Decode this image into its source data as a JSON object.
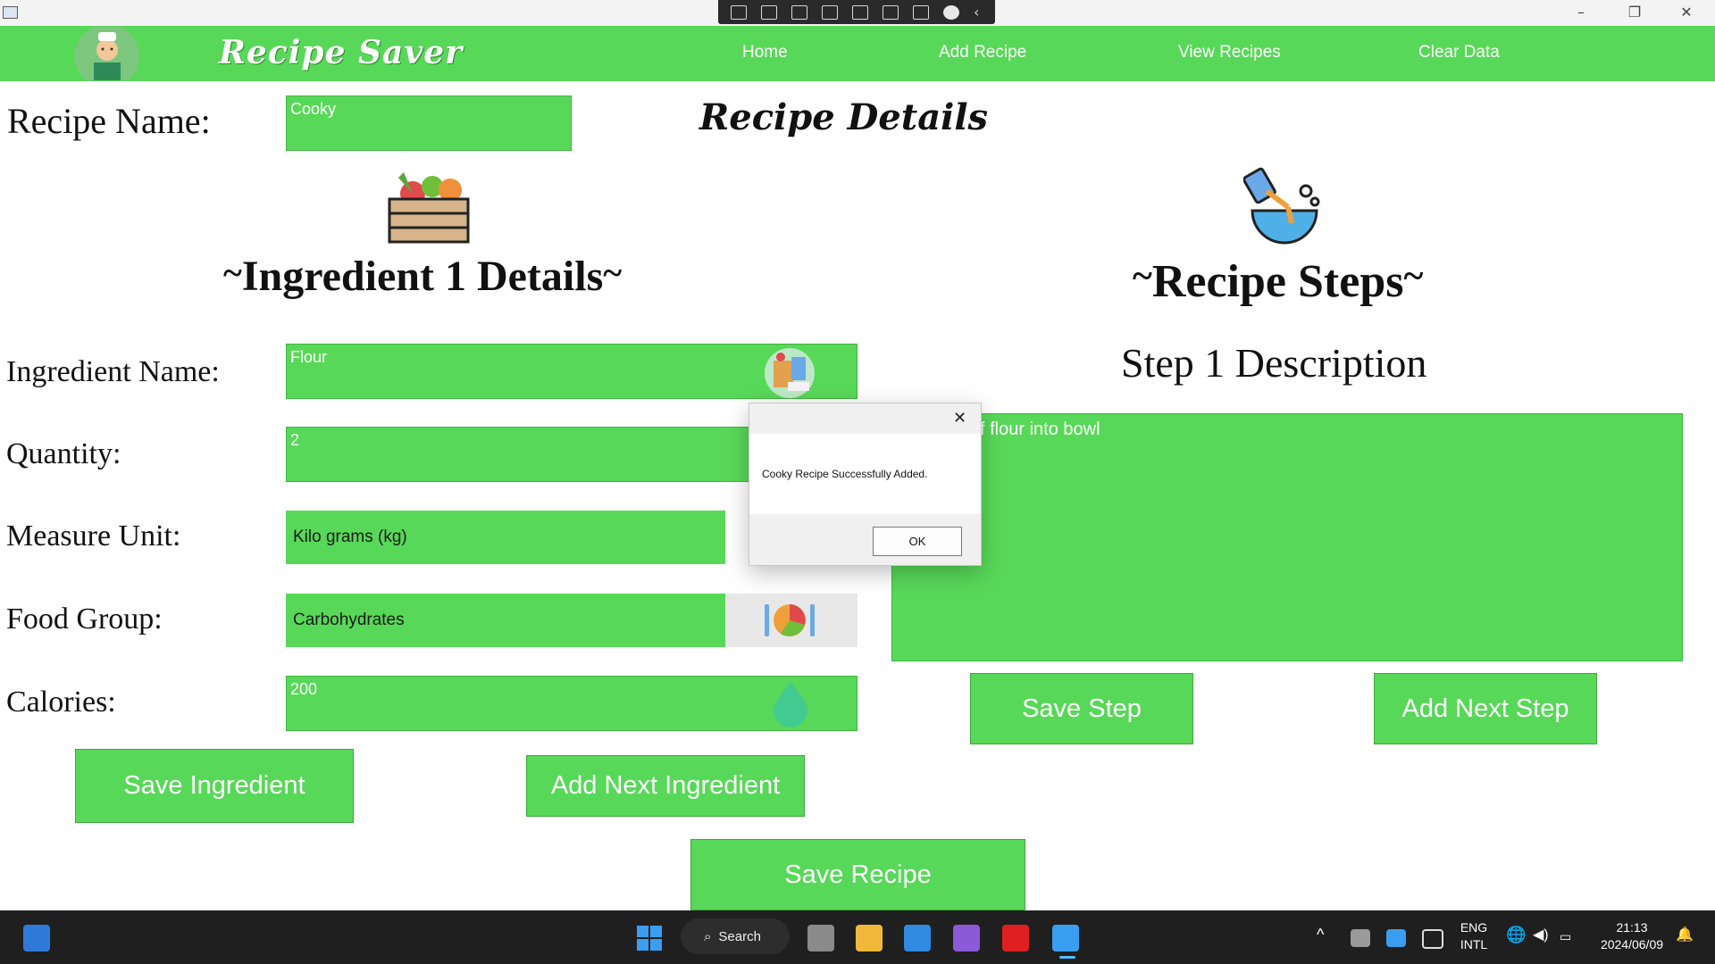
{
  "nav": {
    "brand": "Recipe Saver",
    "links": [
      "Home",
      "Add Recipe",
      "View Recipes",
      "Clear Data"
    ]
  },
  "recipe": {
    "name_label": "Recipe Name:",
    "name_value": "Cooky",
    "details_title": "Recipe Details"
  },
  "ingredient": {
    "section_title": "Ingredient 1 Details",
    "name_label": "Ingredient Name:",
    "name_value": "Flour",
    "quantity_label": "Quantity:",
    "quantity_value": "2",
    "unit_label": "Measure Unit:",
    "unit_value": "Kilo grams (kg)",
    "group_label": "Food Group:",
    "group_value": "Carbohydrates",
    "calories_label": "Calories:",
    "calories_value": "200",
    "save_button": "Save Ingredient",
    "next_button": "Add Next Ingredient"
  },
  "steps": {
    "section_title": "Recipe Steps",
    "step_heading": "Step 1 Description",
    "step_value": "f flour into bowl",
    "save_button": "Save Step",
    "next_button": "Add Next Step"
  },
  "save_recipe_button": "Save Recipe",
  "dialog": {
    "message": "Cooky Recipe Successfully Added.",
    "ok_label": "OK",
    "close_glyph": "✕"
  },
  "taskbar": {
    "search_label": "Search",
    "lang_top": "ENG",
    "lang_bottom": "INTL",
    "time": "21:13",
    "date": "2024/06/09"
  },
  "colors": {
    "accent": "#58d858",
    "white": "#ffffff",
    "taskbar": "#1f1f1f"
  },
  "icons": [
    "app-icon",
    "chef-avatar",
    "vegetable-crate-icon",
    "mixing-bowl-icon",
    "grocery-bag-icon",
    "food-group-plate-icon",
    "kcal-drop-icon",
    "close-icon",
    "windows-start-icon",
    "search-icon"
  ]
}
